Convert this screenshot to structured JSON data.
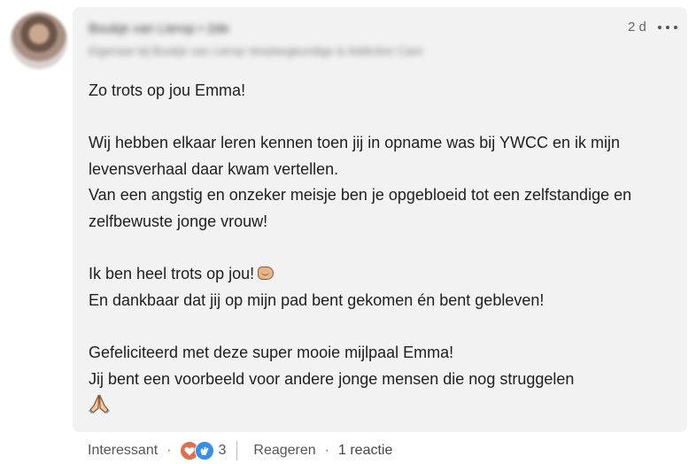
{
  "comment": {
    "author_name": "Boukje van Lierop • 2de",
    "author_headline": "Eigenaar bij Boukje van Lierop Verpleegkundige & Addiction Care",
    "time": "2 d",
    "lines": [
      "Zo trots op jou Emma!",
      "",
      "Wij hebben elkaar leren kennen toen jij in opname was bij YWCC en ik mijn levensverhaal daar kwam vertellen.",
      "Van een angstig en onzeker meisje ben je opgebloeid tot een zelfstandige en zelfbewuste jonge vrouw!",
      "",
      "Ik ben heel trots op jou!",
      "En dankbaar dat jij op mijn pad bent gekomen én bent gebleven!",
      "",
      "Gefeliciteerd met deze super mooie mijlpaal Emma!",
      "Jij bent een voorbeeld voor andere jonge mensen die nog struggelen"
    ]
  },
  "actions": {
    "react_label": "Interessant",
    "separator": "·",
    "reaction_count": "3",
    "reply_label": "Reageren",
    "reply_count": "1 reactie"
  },
  "icons": {
    "more": "more-horizontal-icon",
    "fist": "fist-emoji-icon",
    "pray": "folded-hands-emoji-icon",
    "heart": "heart-reaction-icon",
    "clap": "clap-reaction-icon"
  },
  "colors": {
    "bubble": "#f2f2f2",
    "heart_reaction": "#df704d",
    "clap_reaction": "#378fe9",
    "secondary_text": "#555555"
  }
}
